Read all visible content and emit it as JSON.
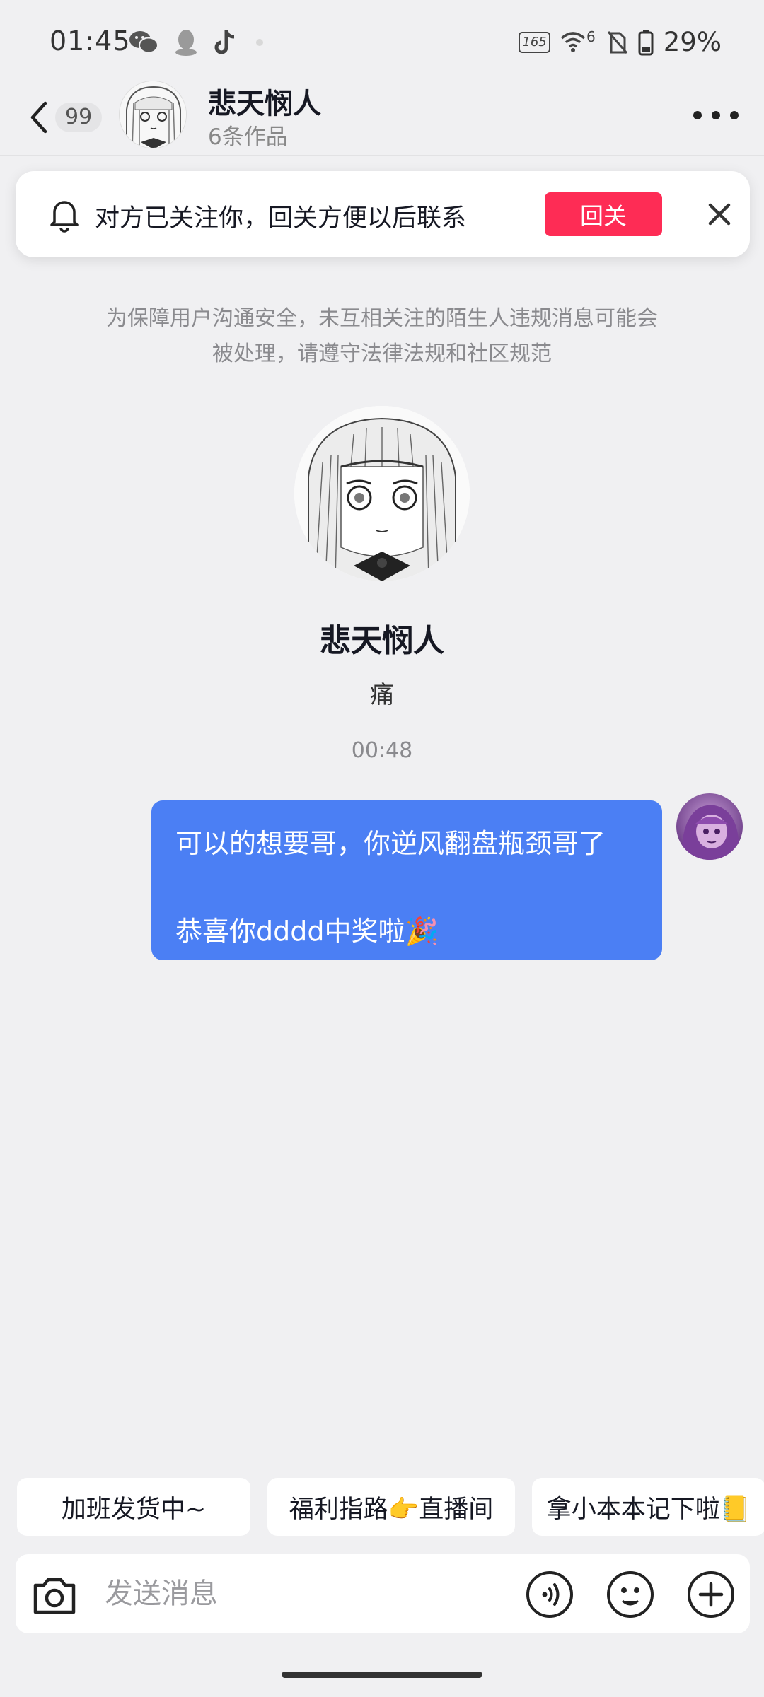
{
  "status_bar": {
    "time": "01:45",
    "battery_percent": "29%",
    "refresh_rate_label": "165",
    "wifi_label": "6",
    "left_icons": [
      "wechat-icon",
      "qq-icon",
      "tiktok-icon"
    ],
    "right_icons": [
      "refresh-rate-icon",
      "wifi-icon",
      "no-sim-icon",
      "battery-icon"
    ]
  },
  "header": {
    "unread_count": "99",
    "contact_name": "悲天悯人",
    "works_count": "6条作品"
  },
  "follow_banner": {
    "text": "对方已关注你，回关方便以后联系",
    "button_label": "回关"
  },
  "notice": {
    "line1": "为保障用户沟通安全，未互相关注的陌生人违规消息可能会",
    "line2": "被处理，请遵守法律法规和社区规范"
  },
  "profile": {
    "name": "悲天悯人",
    "signature": "痛"
  },
  "messages": [
    {
      "time": "00:48",
      "line1": "可以的想要哥，你逆风翻盘瓶颈哥了",
      "line2": "恭喜你dddd中奖啦🎉",
      "sender": "self"
    }
  ],
  "quick_replies": [
    "加班发货中~",
    "福利指路👉直播间",
    "拿小本本记下啦📒"
  ],
  "input": {
    "placeholder": "发送消息"
  },
  "colors": {
    "accent_red": "#fe2c55",
    "bubble_blue": "#4b7ff4",
    "background": "#f0f0f2"
  }
}
